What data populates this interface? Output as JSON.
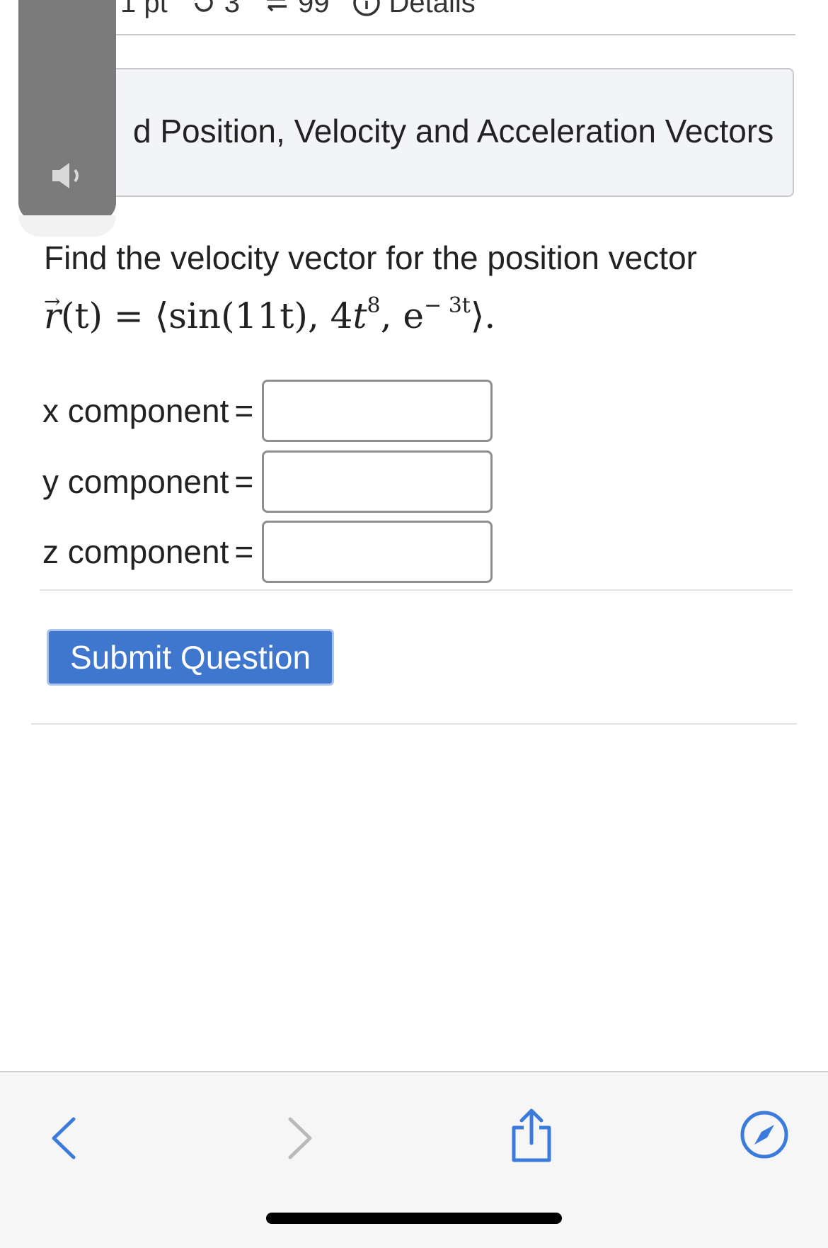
{
  "header": {
    "points": "1 pt",
    "retries": "3",
    "attempts": "99",
    "details_label": "Details"
  },
  "title": {
    "text": "d Position, Velocity and Acceleration Vectors"
  },
  "question": {
    "prompt": "Find the velocity vector for the position vector",
    "math": {
      "lhs": "r",
      "arg": "(t)",
      "equals": "=",
      "open": "⟨",
      "c1": "sin(11t), 4",
      "c2": "t",
      "c2_exp": "8",
      "c3": ", e",
      "c3_exp": "− 3t",
      "close": "⟩."
    }
  },
  "components": [
    {
      "label": "x component",
      "eq": "=",
      "value": ""
    },
    {
      "label": "y component",
      "eq": "=",
      "value": ""
    },
    {
      "label": "z component",
      "eq": "=",
      "value": ""
    }
  ],
  "submit_label": "Submit Question",
  "colors": {
    "accent": "#3f77cf",
    "title_bg": "#f3f4f8",
    "overlay": "#7b7b7b"
  },
  "icons": {
    "retry": "retry-icon",
    "attempts": "attempts-icon",
    "details": "info-icon",
    "speaker": "speaker-icon",
    "back": "chevron-left-icon",
    "forward": "chevron-right-icon",
    "share": "share-icon",
    "browser": "compass-icon"
  }
}
